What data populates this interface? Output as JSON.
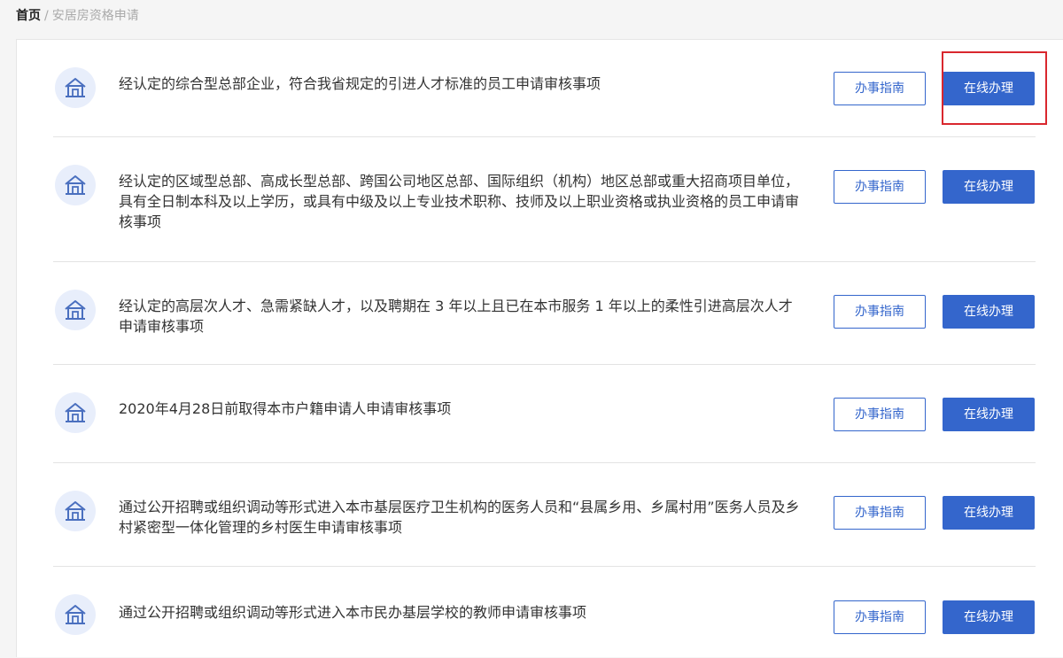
{
  "breadcrumb": {
    "home": "首页",
    "separator": "/",
    "current": "安居房资格申请"
  },
  "colors": {
    "accent": "#3466cc",
    "icon_bg": "#e8eefb",
    "highlight": "#d9272e"
  },
  "actions": {
    "guide_label": "办事指南",
    "online_label": "在线办理"
  },
  "items": [
    {
      "icon": "house-icon",
      "text": "经认定的综合型总部企业，符合我省规定的引进人才标准的员工申请审核事项"
    },
    {
      "icon": "house-icon",
      "text": "经认定的区域型总部、高成长型总部、跨国公司地区总部、国际组织（机构）地区总部或重大招商项目单位，具有全日制本科及以上学历，或具有中级及以上专业技术职称、技师及以上职业资格或执业资格的员工申请审核事项"
    },
    {
      "icon": "house-icon",
      "text": "经认定的高层次人才、急需紧缺人才，以及聘期在 3 年以上且已在本市服务 1 年以上的柔性引进高层次人才申请审核事项"
    },
    {
      "icon": "house-icon",
      "text": "2020年4月28日前取得本市户籍申请人申请审核事项"
    },
    {
      "icon": "house-icon",
      "text": "通过公开招聘或组织调动等形式进入本市基层医疗卫生机构的医务人员和“县属乡用、乡属村用”医务人员及乡村紧密型一体化管理的乡村医生申请审核事项"
    },
    {
      "icon": "house-icon",
      "text": "通过公开招聘或组织调动等形式进入本市民办基层学校的教师申请审核事项"
    }
  ]
}
